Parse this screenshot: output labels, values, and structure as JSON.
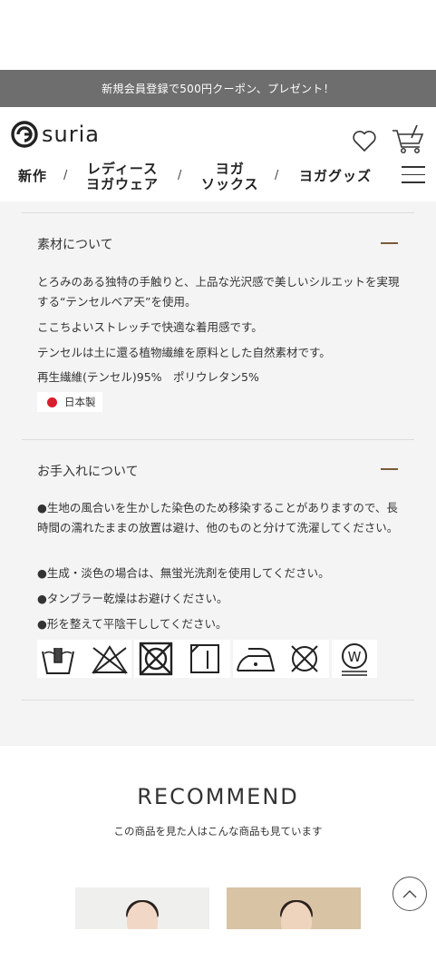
{
  "banner": {
    "text": "新規会員登録で500円クーポン、プレゼント！"
  },
  "header": {
    "logo_text": "suria",
    "nav": [
      {
        "line1": "新作",
        "line2": ""
      },
      {
        "line1": "レディース",
        "line2": "ヨガウェア"
      },
      {
        "line1": "ヨガ",
        "line2": "ソックス"
      },
      {
        "line1": "ヨガグッズ",
        "line2": ""
      }
    ],
    "separator": "/"
  },
  "material": {
    "title": "素材について",
    "paragraphs": [
      "とろみのある独特の手触りと、上品な光沢感で美しいシルエットを実現する“テンセルベア天”を使用。",
      "ここちよいストレッチで快適な着用感です。",
      "テンセルは土に還る植物繊維を原料とした自然素材です。",
      "再生繊維(テンセル)95%　ポリウレタン5%"
    ],
    "origin": "日本製"
  },
  "care": {
    "title": "お手入れについて",
    "paragraphs": [
      "●生地の風合いを生かした染色のため移染することがありますので、長時間の濡れたままの放置は避け、他のものと分けて洗濯してください。",
      "●生成・淡色の場合は、無蛍光洗剤を使用してください。",
      "●タンブラー乾燥はお避けください。",
      "●形を整えて平陰干ししてください。"
    ],
    "symbols": [
      "hand-wash-icon",
      "no-bleach-icon",
      "no-tumble-dry-icon",
      "shade-flat-dry-icon",
      "low-iron-icon",
      "no-dry-clean-icon",
      "wet-clean-icon"
    ]
  },
  "recommend": {
    "title": "RECOMMEND",
    "subtitle": "この商品を見た人はこんな商品も見ています"
  },
  "colors": {
    "banner_bg": "#6e6e6e",
    "accent_minus": "#7a5a3a",
    "section_bg": "#f4f4f4"
  }
}
